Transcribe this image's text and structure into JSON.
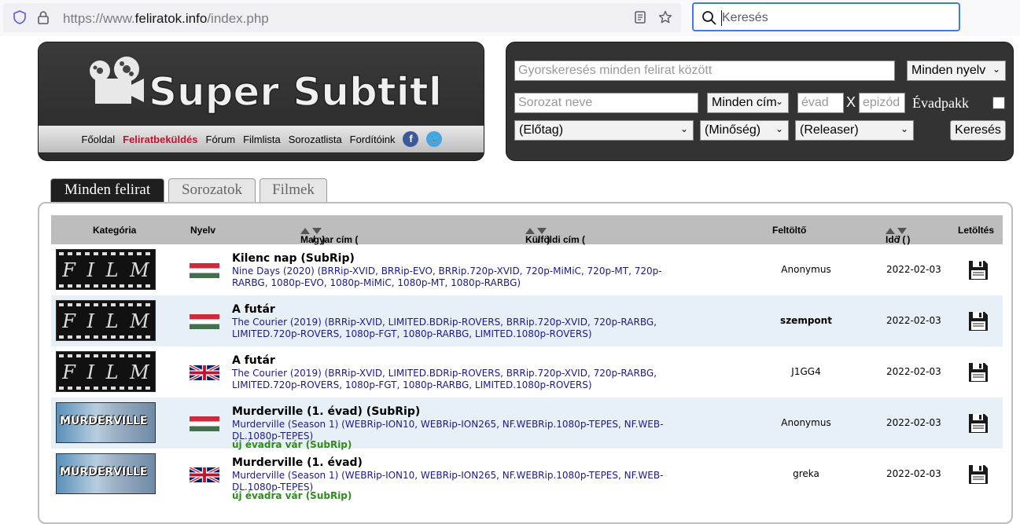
{
  "browser": {
    "url_prefix": "https://www.",
    "url_domain": "feliratok.info",
    "url_path": "/index.php",
    "search_placeholder": "Keresés"
  },
  "nav": {
    "items": [
      "Főoldal",
      "Feliratbeküldés",
      "Fórum",
      "Filmlista",
      "Sorozatlista",
      "Fordítóink"
    ]
  },
  "search": {
    "quick_placeholder": "Gyorskeresés minden felirat között",
    "lang_select": "Minden nyelv",
    "series_placeholder": "Sorozat neve",
    "series_select": "Minden cím",
    "season_placeholder": "évad",
    "x_label": "X",
    "episode_placeholder": "epizód",
    "season_pack_label": "Évadpakk",
    "prefix_select": "(Előtag)",
    "quality_select": "(Minőség)",
    "releaser_select": "(Releaser)",
    "search_button": "Keresés"
  },
  "tabs": [
    "Minden felirat",
    "Sorozatok",
    "Filmek"
  ],
  "table": {
    "headers": {
      "category": "Kategória",
      "language": "Nyelv",
      "hu_title": "Magyar cím (",
      "foreign_title": "Külföldi cím (",
      "uploader": "Feltöltő",
      "time": "Idő (",
      "download": "Letöltés",
      "sep": "/",
      "close": ")"
    },
    "rows": [
      {
        "category": "film",
        "film_letters": [
          "F",
          "I",
          "L",
          "M"
        ],
        "flag": "hu",
        "hu_title": "Kilenc nap (SubRip)",
        "foreign_title": "Nine Days (2020) (BRRip-XVID, BRRip-EVO, BRRip.720p-XVID, 720p-MiMiC, 720p-MT, 720p-RARBG, 1080p-EVO, 1080p-MiMiC, 1080p-MT, 1080p-RARBG)",
        "note": "",
        "uploader": "Anonymus",
        "uploader_bold": false,
        "date": "2022-02-03"
      },
      {
        "category": "film",
        "film_letters": [
          "F",
          "I",
          "L",
          "M"
        ],
        "flag": "hu",
        "hu_title": "A futár",
        "foreign_title": "The Courier (2019) (BRRip-XVID, LIMITED.BDRip-ROVERS, BRRip.720p-XVID, 720p-RARBG, LIMITED.720p-ROVERS, 1080p-FGT, 1080p-RARBG, LIMITED.1080p-ROVERS)",
        "note": "",
        "uploader": "szempont",
        "uploader_bold": true,
        "date": "2022-02-03"
      },
      {
        "category": "film",
        "film_letters": [
          "F",
          "I",
          "L",
          "M"
        ],
        "flag": "uk",
        "hu_title": "A futár",
        "foreign_title": "The Courier (2019) (BRRip-XVID, LIMITED.BDRip-ROVERS, BRRip.720p-XVID, 720p-RARBG, LIMITED.720p-ROVERS, 1080p-FGT, 1080p-RARBG, LIMITED.1080p-ROVERS)",
        "note": "",
        "uploader": "J1GG4",
        "uploader_bold": false,
        "date": "2022-02-03"
      },
      {
        "category": "series",
        "series_logo": "MURDERVILLE",
        "flag": "hu",
        "hu_title": "Murderville (1. évad) (SubRip)",
        "foreign_title": "Murderville (Season 1) (WEBRip-ION10, WEBRip-ION265, NF.WEBRip.1080p-TEPES, NF.WEB-DL.1080p-TEPES)",
        "note": "új évadra vár (SubRip)",
        "uploader": "Anonymus",
        "uploader_bold": false,
        "date": "2022-02-03"
      },
      {
        "category": "series",
        "series_logo": "MURDERVILLE",
        "flag": "uk",
        "hu_title": "Murderville (1. évad)",
        "foreign_title": "Murderville (Season 1) (WEBRip-ION10, WEBRip-ION265, NF.WEBRip.1080p-TEPES, NF.WEB-DL.1080p-TEPES)",
        "note": "új évadra vár (SubRip)",
        "uploader": "greka",
        "uploader_bold": false,
        "date": "2022-02-03"
      }
    ]
  },
  "logo_text": "Super Subtitles"
}
